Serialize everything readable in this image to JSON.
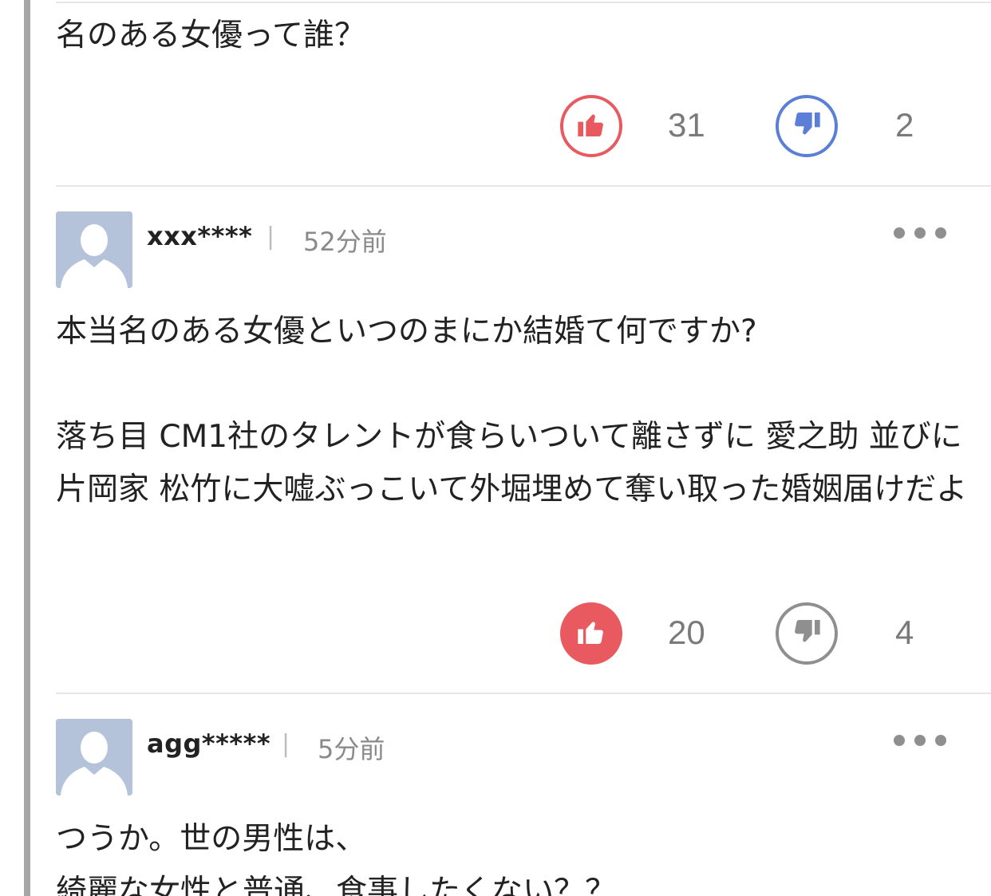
{
  "colors": {
    "accent_red": "#e85a5f",
    "accent_blue": "#5b7fd6",
    "neutral_gray": "#8f8f8f"
  },
  "comments": [
    {
      "body": "名のある女優って誰？",
      "votes": {
        "up": {
          "icon": "thumbs-up-icon",
          "count": "31",
          "state": "outlined-red"
        },
        "down": {
          "icon": "thumbs-down-icon",
          "count": "2",
          "state": "outlined-blue"
        }
      }
    },
    {
      "user": "xxx****",
      "separator": "|",
      "time": "52分前",
      "more_icon": "more-horizontal-icon",
      "body": "本当名のある女優といつのまにか結婚て何ですか?\n\n落ち目 CM1社のタレントが食らいついて離さずに 愛之助 並びに片岡家 松竹に大嘘ぶっこいて外堀埋めて奪い取った婚姻届けだよ",
      "votes": {
        "up": {
          "icon": "thumbs-up-icon",
          "count": "20",
          "state": "filled-red"
        },
        "down": {
          "icon": "thumbs-down-icon",
          "count": "4",
          "state": "outlined-gray"
        }
      }
    },
    {
      "user": "agg*****",
      "separator": "|",
      "time": "5分前",
      "more_icon": "more-horizontal-icon",
      "body": "つうか。世の男性は、\n綺麗な女性と普通、食事したくない？？"
    }
  ]
}
